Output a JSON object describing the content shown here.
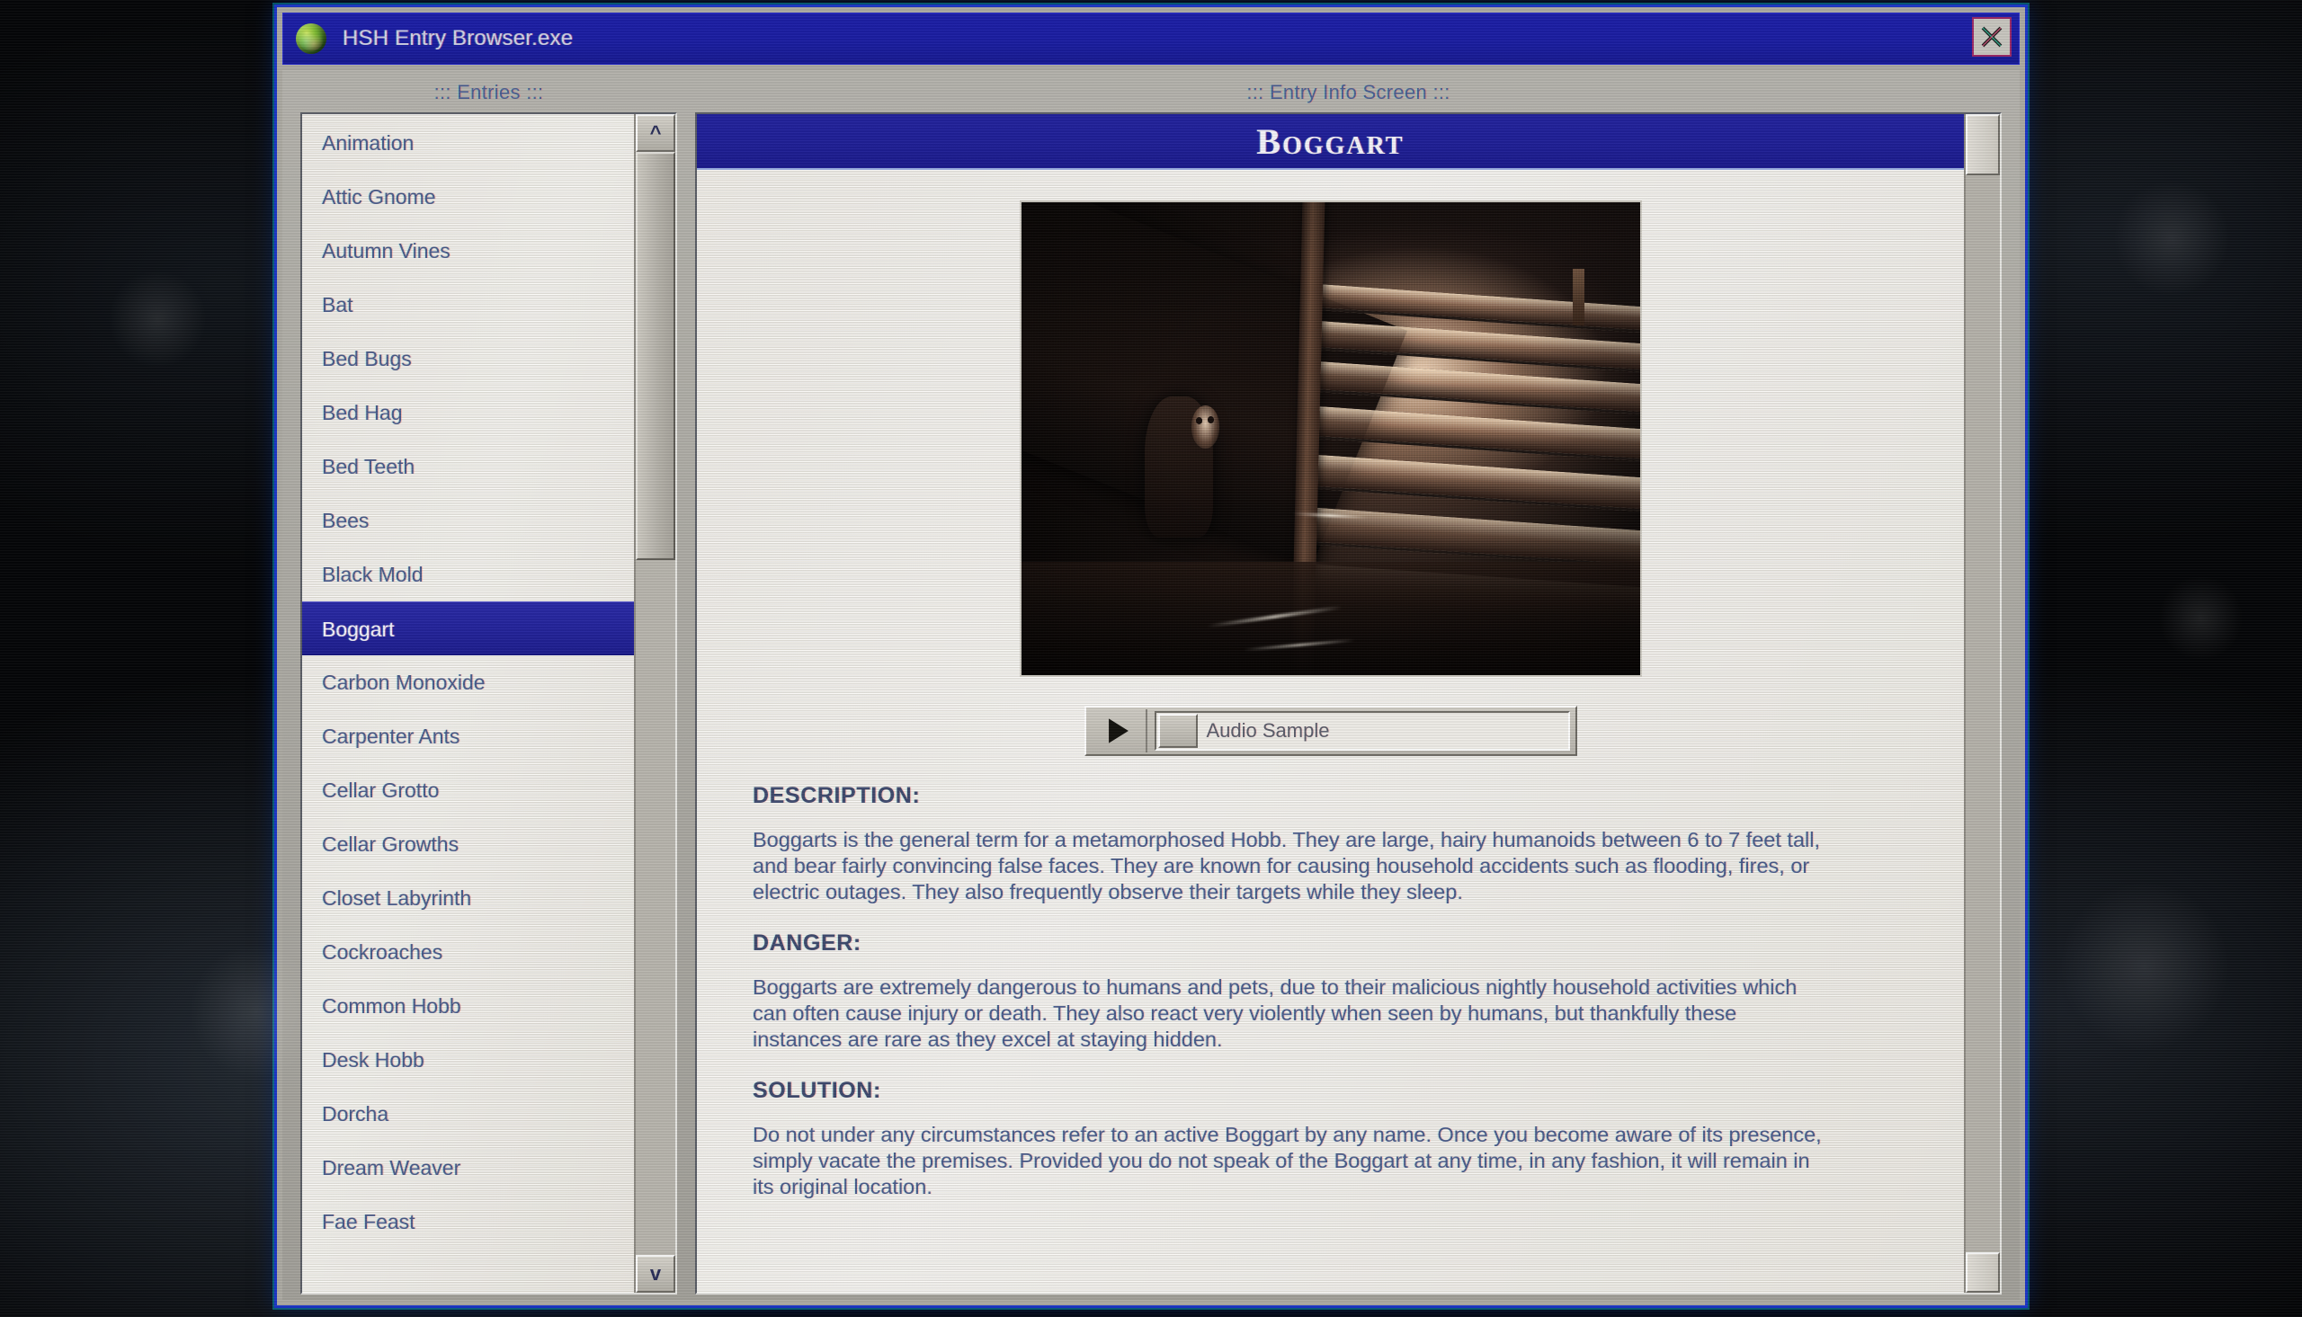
{
  "window": {
    "title": "HSH Entry Browser.exe",
    "app_icon": "green-orb-icon",
    "close_label": "close-icon",
    "accent_blue": "#1f1f96",
    "frame_blue": "#1b35c8",
    "body_gray": "#adaba4",
    "text_blue": "#4a5c8c"
  },
  "left_pane": {
    "caption": "::: Entries :::",
    "selected": "Boggart",
    "scroll_up": "^",
    "scroll_down": "v",
    "items": [
      "Animation",
      "Attic Gnome",
      "Autumn Vines",
      "Bat",
      "Bed Bugs",
      "Bed Hag",
      "Bed Teeth",
      "Bees",
      "Black Mold",
      "Boggart",
      "Carbon Monoxide",
      "Carpenter Ants",
      "Cellar Grotto",
      "Cellar Growths",
      "Closet Labyrinth",
      "Cockroaches",
      "Common Hobb",
      "Desk Hobb",
      "Dorcha",
      "Dream Weaver",
      "Fae Feast"
    ]
  },
  "right_pane": {
    "caption": "::: Entry Info Screen :::",
    "entry_title": "Boggart",
    "image_alt": "dark basement staircase photograph",
    "audio": {
      "play_label": "play-icon",
      "label": "Audio Sample"
    },
    "sections": [
      {
        "heading": "DESCRIPTION:",
        "body": "Boggarts is the general term for a metamorphosed Hobb. They are large, hairy humanoids between 6 to 7 feet tall, and bear fairly convincing false faces. They are known for causing household accidents such as flooding, fires, or electric outages. They also frequently observe their targets while they sleep."
      },
      {
        "heading": "DANGER:",
        "body": "Boggarts are extremely dangerous to humans and pets, due to their malicious nightly household activities which can often cause injury or death. They also react very violently when seen by humans, but thankfully these instances are rare as they excel at staying hidden."
      },
      {
        "heading": "SOLUTION:",
        "body": "Do not under any circumstances refer to an active Boggart by any name. Once you become aware of its presence, simply vacate the premises. Provided you do not speak of the Boggart at any time, in any fashion, it will remain in its original location."
      }
    ]
  }
}
